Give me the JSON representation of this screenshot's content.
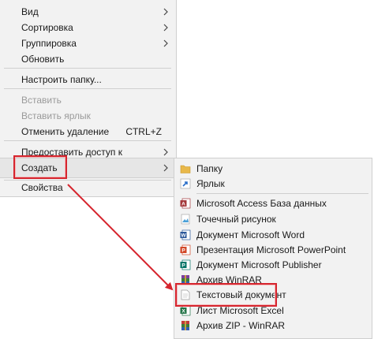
{
  "main_menu": {
    "items": [
      {
        "label": "Вид"
      },
      {
        "label": "Сортировка"
      },
      {
        "label": "Группировка"
      },
      {
        "label": "Обновить"
      },
      {
        "label": "Настроить папку..."
      },
      {
        "label": "Вставить"
      },
      {
        "label": "Вставить ярлык"
      },
      {
        "label": "Отменить удаление",
        "shortcut": "CTRL+Z"
      },
      {
        "label": "Предоставить доступ к"
      },
      {
        "label": "Создать"
      },
      {
        "label": "Свойства"
      }
    ]
  },
  "submenu": {
    "items": [
      {
        "label": "Папку",
        "icon": "folder-icon"
      },
      {
        "label": "Ярлык",
        "icon": "shortcut-icon"
      },
      {
        "label": "Microsoft Access База данных",
        "icon": "access-icon"
      },
      {
        "label": "Точечный рисунок",
        "icon": "bitmap-icon"
      },
      {
        "label": "Документ Microsoft Word",
        "icon": "word-icon"
      },
      {
        "label": "Презентация Microsoft PowerPoint",
        "icon": "powerpoint-icon"
      },
      {
        "label": "Документ Microsoft Publisher",
        "icon": "publisher-icon"
      },
      {
        "label": "Архив WinRAR",
        "icon": "winrar-icon"
      },
      {
        "label": "Текстовый документ",
        "icon": "text-document-icon"
      },
      {
        "label": "Лист Microsoft Excel",
        "icon": "excel-icon"
      },
      {
        "label": "Архив ZIP - WinRAR",
        "icon": "winrar-zip-icon"
      }
    ]
  },
  "colors": {
    "highlight_red": "#d6252e",
    "menu_bg": "#f2f2f2",
    "disabled_text": "#9a9a9a"
  }
}
